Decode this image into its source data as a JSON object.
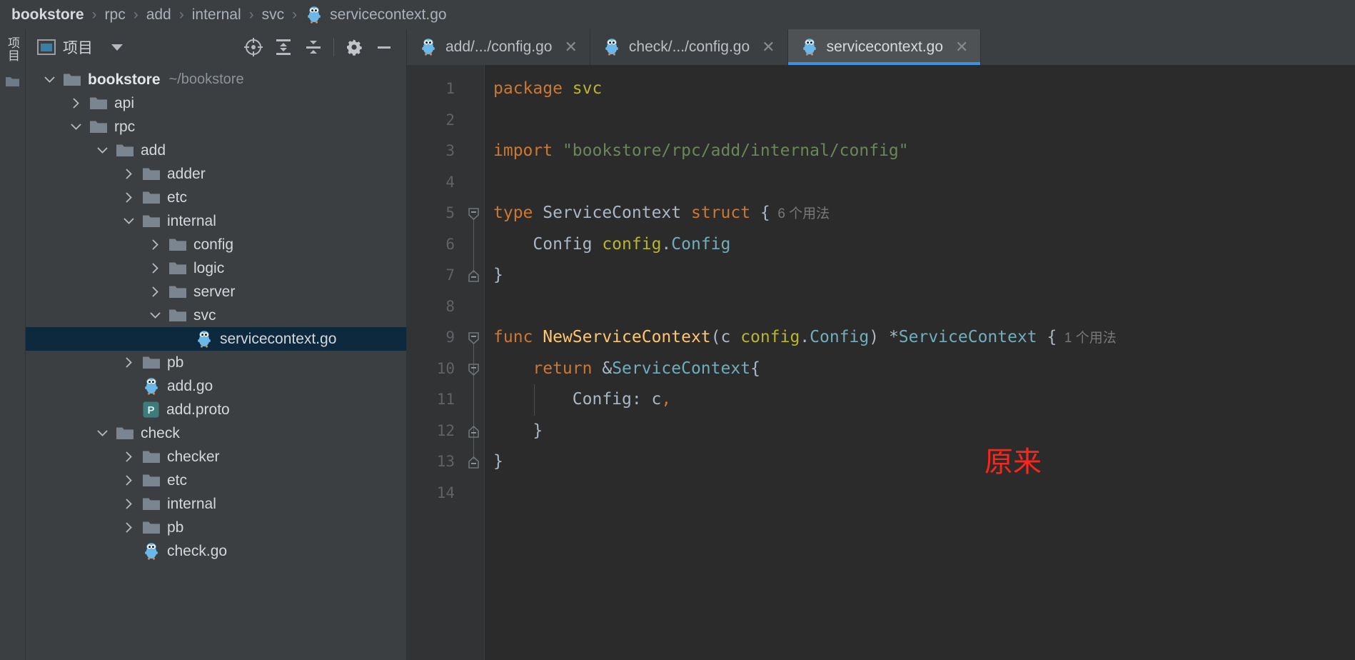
{
  "breadcrumb": {
    "items": [
      {
        "label": "bookstore",
        "icon": null
      },
      {
        "label": "rpc",
        "icon": null
      },
      {
        "label": "add",
        "icon": null
      },
      {
        "label": "internal",
        "icon": null
      },
      {
        "label": "svc",
        "icon": null
      },
      {
        "label": "servicecontext.go",
        "icon": "go-gopher-icon"
      }
    ],
    "separator": "›"
  },
  "tool_rail": {
    "vertical_label": "项目",
    "folder_icon": "folder-icon"
  },
  "project_panel": {
    "title": "项目",
    "title_icon": "project-window-icon",
    "dropdown_icon": "chevron-down-icon",
    "toolbar_buttons": [
      {
        "name": "select-opened-file-icon",
        "label": ""
      },
      {
        "name": "expand-all-icon",
        "label": ""
      },
      {
        "name": "collapse-all-icon",
        "label": ""
      },
      {
        "name": "settings-gear-icon",
        "label": ""
      },
      {
        "name": "hide-panel-icon",
        "label": ""
      }
    ],
    "tree": [
      {
        "depth": 0,
        "arrow": "down",
        "icon": "folder-icon",
        "label": "bookstore",
        "bold": true,
        "path": "~/bookstore",
        "selected": false
      },
      {
        "depth": 1,
        "arrow": "right",
        "icon": "folder-icon",
        "label": "api",
        "bold": false,
        "path": "",
        "selected": false
      },
      {
        "depth": 1,
        "arrow": "down",
        "icon": "folder-icon",
        "label": "rpc",
        "bold": false,
        "path": "",
        "selected": false
      },
      {
        "depth": 2,
        "arrow": "down",
        "icon": "folder-icon",
        "label": "add",
        "bold": false,
        "path": "",
        "selected": false
      },
      {
        "depth": 3,
        "arrow": "right",
        "icon": "folder-icon",
        "label": "adder",
        "bold": false,
        "path": "",
        "selected": false
      },
      {
        "depth": 3,
        "arrow": "right",
        "icon": "folder-icon",
        "label": "etc",
        "bold": false,
        "path": "",
        "selected": false
      },
      {
        "depth": 3,
        "arrow": "down",
        "icon": "folder-icon",
        "label": "internal",
        "bold": false,
        "path": "",
        "selected": false
      },
      {
        "depth": 4,
        "arrow": "right",
        "icon": "folder-icon",
        "label": "config",
        "bold": false,
        "path": "",
        "selected": false
      },
      {
        "depth": 4,
        "arrow": "right",
        "icon": "folder-icon",
        "label": "logic",
        "bold": false,
        "path": "",
        "selected": false
      },
      {
        "depth": 4,
        "arrow": "right",
        "icon": "folder-icon",
        "label": "server",
        "bold": false,
        "path": "",
        "selected": false
      },
      {
        "depth": 4,
        "arrow": "down",
        "icon": "folder-icon",
        "label": "svc",
        "bold": false,
        "path": "",
        "selected": false
      },
      {
        "depth": 5,
        "arrow": "none",
        "icon": "go-gopher-icon",
        "label": "servicecontext.go",
        "bold": false,
        "path": "",
        "selected": true
      },
      {
        "depth": 3,
        "arrow": "right",
        "icon": "folder-icon",
        "label": "pb",
        "bold": false,
        "path": "",
        "selected": false
      },
      {
        "depth": 3,
        "arrow": "none",
        "icon": "go-gopher-icon",
        "label": "add.go",
        "bold": false,
        "path": "",
        "selected": false
      },
      {
        "depth": 3,
        "arrow": "none",
        "icon": "proto-file-icon",
        "label": "add.proto",
        "bold": false,
        "path": "",
        "selected": false
      },
      {
        "depth": 2,
        "arrow": "down",
        "icon": "folder-icon",
        "label": "check",
        "bold": false,
        "path": "",
        "selected": false
      },
      {
        "depth": 3,
        "arrow": "right",
        "icon": "folder-icon",
        "label": "checker",
        "bold": false,
        "path": "",
        "selected": false
      },
      {
        "depth": 3,
        "arrow": "right",
        "icon": "folder-icon",
        "label": "etc",
        "bold": false,
        "path": "",
        "selected": false
      },
      {
        "depth": 3,
        "arrow": "right",
        "icon": "folder-icon",
        "label": "internal",
        "bold": false,
        "path": "",
        "selected": false
      },
      {
        "depth": 3,
        "arrow": "right",
        "icon": "folder-icon",
        "label": "pb",
        "bold": false,
        "path": "",
        "selected": false
      },
      {
        "depth": 3,
        "arrow": "none",
        "icon": "go-gopher-icon",
        "label": "check.go",
        "bold": false,
        "path": "",
        "selected": false
      }
    ]
  },
  "editor": {
    "tabs": [
      {
        "label": "add/.../config.go",
        "icon": "go-gopher-icon",
        "active": false,
        "close": "✕"
      },
      {
        "label": "check/.../config.go",
        "icon": "go-gopher-icon",
        "active": false,
        "close": "✕"
      },
      {
        "label": "servicecontext.go",
        "icon": "go-gopher-icon",
        "active": true,
        "close": "✕"
      }
    ],
    "line_numbers": [
      "1",
      "2",
      "3",
      "4",
      "5",
      "6",
      "7",
      "8",
      "9",
      "10",
      "11",
      "12",
      "13",
      "14"
    ],
    "code_lines": [
      {
        "n": 1,
        "tokens": [
          {
            "t": "package",
            "c": "kw"
          },
          {
            "t": " ",
            "c": "pln"
          },
          {
            "t": "svc",
            "c": "pkg"
          }
        ]
      },
      {
        "n": 2,
        "tokens": []
      },
      {
        "n": 3,
        "tokens": [
          {
            "t": "import",
            "c": "kw"
          },
          {
            "t": " ",
            "c": "pln"
          },
          {
            "t": "\"bookstore/rpc/add/internal/config\"",
            "c": "str"
          }
        ]
      },
      {
        "n": 4,
        "tokens": []
      },
      {
        "n": 5,
        "tokens": [
          {
            "t": "type",
            "c": "kw"
          },
          {
            "t": " ",
            "c": "pln"
          },
          {
            "t": "ServiceContext",
            "c": "typ"
          },
          {
            "t": " ",
            "c": "pln"
          },
          {
            "t": "struct",
            "c": "kw"
          },
          {
            "t": " {",
            "c": "pln"
          }
        ],
        "hint": "6 个用法"
      },
      {
        "n": 6,
        "tokens": [
          {
            "t": "    Config ",
            "c": "pln"
          },
          {
            "t": "config",
            "c": "pkg"
          },
          {
            "t": ".",
            "c": "pln"
          },
          {
            "t": "Config",
            "c": "cls"
          }
        ]
      },
      {
        "n": 7,
        "tokens": [
          {
            "t": "}",
            "c": "pln"
          }
        ]
      },
      {
        "n": 8,
        "tokens": []
      },
      {
        "n": 9,
        "tokens": [
          {
            "t": "func",
            "c": "kw"
          },
          {
            "t": " ",
            "c": "pln"
          },
          {
            "t": "NewServiceContext",
            "c": "fn"
          },
          {
            "t": "(c ",
            "c": "pln"
          },
          {
            "t": "config",
            "c": "pkg"
          },
          {
            "t": ".",
            "c": "pln"
          },
          {
            "t": "Config",
            "c": "cls"
          },
          {
            "t": ") *",
            "c": "pln"
          },
          {
            "t": "ServiceContext",
            "c": "cls"
          },
          {
            "t": " {",
            "c": "pln"
          }
        ],
        "hint": "1 个用法"
      },
      {
        "n": 10,
        "tokens": [
          {
            "t": "    ",
            "c": "pln"
          },
          {
            "t": "return",
            "c": "kw"
          },
          {
            "t": " &",
            "c": "pln"
          },
          {
            "t": "ServiceContext",
            "c": "cls"
          },
          {
            "t": "{",
            "c": "pln"
          }
        ]
      },
      {
        "n": 11,
        "tokens": [
          {
            "t": "        Config: c",
            "c": "pln"
          },
          {
            "t": ",",
            "c": "kw"
          }
        ]
      },
      {
        "n": 12,
        "tokens": [
          {
            "t": "    }",
            "c": "pln"
          }
        ]
      },
      {
        "n": 13,
        "tokens": [
          {
            "t": "}",
            "c": "pln"
          }
        ]
      },
      {
        "n": 14,
        "tokens": []
      }
    ],
    "annotation": "原来"
  },
  "colors": {
    "accent_blue": "#3d91de",
    "selection_navy": "#0d293e",
    "annotation_red": "#ff2419",
    "keyword_orange": "#cc7832",
    "string_green": "#6a8759",
    "function_yellow": "#ffc66d",
    "type_teal": "#6fafbd",
    "package_olive": "#bbb529"
  }
}
